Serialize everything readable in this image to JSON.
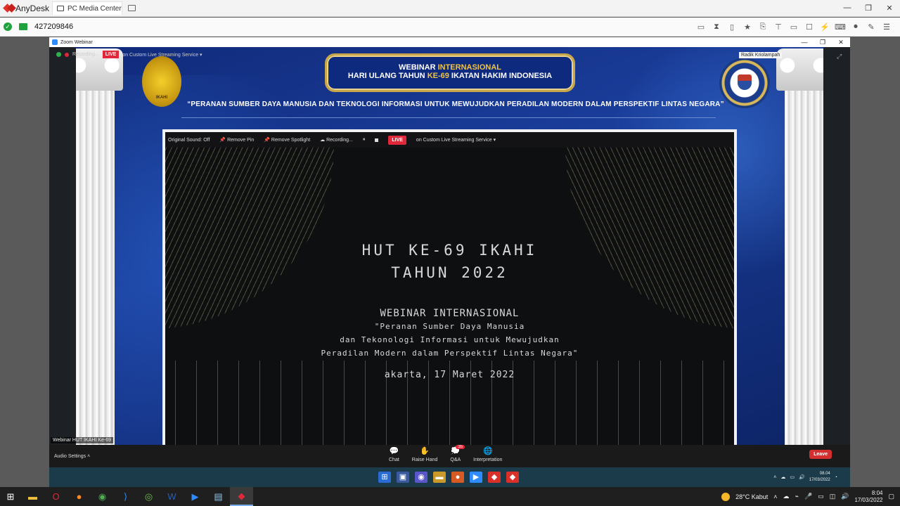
{
  "anydesk": {
    "app_name": "AnyDesk",
    "tab_label": "PC Media Center",
    "address": "427209846"
  },
  "zoom": {
    "window_title": "Zoom Webinar",
    "recording_label": "Recording...",
    "live_label": "LIVE",
    "stream_label": "on Custom Live Streaming Service",
    "speaker_name": "Radik Kriolampah",
    "participant_label": "Webinar HUT IKAHI Ke-69",
    "audio_settings": "Audio Settings",
    "controls": {
      "chat": "Chat",
      "raise_hand": "Raise Hand",
      "qa": "Q&A",
      "qa_badge": "35",
      "interpretation": "Interpretation"
    },
    "leave_label": "Leave"
  },
  "slide": {
    "banner_line1_prefix": "WEBINAR ",
    "banner_line1_gold": "INTERNASIONAL",
    "banner_line2_prefix": "HARI ULANG TAHUN ",
    "banner_line2_gold": "KE-69",
    "banner_line2_suffix": " IKATAN HAKIM INDONESIA",
    "subtitle": "“PERANAN SUMBER DAYA MANUSIA DAN TEKNOLOGI INFORMASI UNTUK MEWUJUDKAN PERADILAN MODERN DALAM PERSPEKTIF LINTAS NEGARA”",
    "ikahi_logo_text": "IKAHI"
  },
  "video": {
    "original_sound": "Original Sound: Off",
    "remove_pin": "Remove Pin",
    "remove_spotlight": "Remove Spotlight",
    "recording": "Recording...",
    "live": "LIVE",
    "stream": "on Custom Live Streaming Service",
    "line1": "HUT KE-69 IKAHI",
    "line2": "TAHUN 2022",
    "line3": "WEBINAR INTERNASIONAL",
    "line4": "\"Peranan Sumber Daya Manusia",
    "line5": "dan Tekonologi Informasi untuk Mewujudkan",
    "line6": "Peradilan Modern dalam Perspektif Lintas Negara\"",
    "line7": "akarta, 17 Maret 2022"
  },
  "remote_taskbar": {
    "time": "08.04",
    "date": "17/03/2022"
  },
  "local_taskbar": {
    "weather": "28°C  Kabut",
    "time": "8:04",
    "date": "17/03/2022"
  }
}
